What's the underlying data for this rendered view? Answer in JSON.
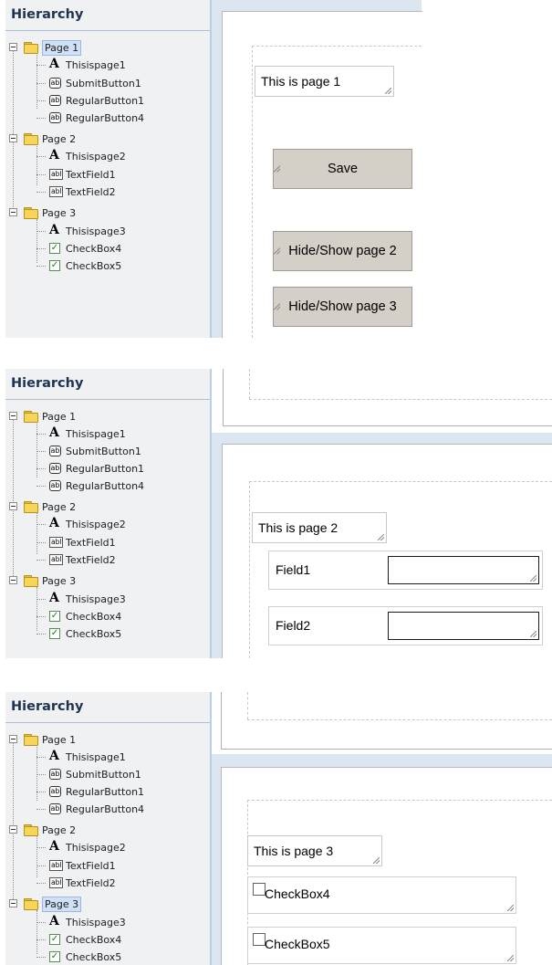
{
  "hierarchy": {
    "title": "Hierarchy",
    "pages": [
      {
        "label": "Page 1",
        "children": [
          {
            "icon": "text-A-icon",
            "label": "Thisispage1"
          },
          {
            "icon": "button-ab-icon",
            "label": "SubmitButton1"
          },
          {
            "icon": "button-ab-icon",
            "label": "RegularButton1"
          },
          {
            "icon": "button-ab-icon",
            "label": "RegularButton4"
          }
        ]
      },
      {
        "label": "Page 2",
        "children": [
          {
            "icon": "text-A-icon",
            "label": "Thisispage2"
          },
          {
            "icon": "textfield-abl-icon",
            "label": "TextField1"
          },
          {
            "icon": "textfield-abl-icon",
            "label": "TextField2"
          }
        ]
      },
      {
        "label": "Page 3",
        "children": [
          {
            "icon": "text-A-icon",
            "label": "Thisispage3"
          },
          {
            "icon": "checkbox-icon",
            "label": "CheckBox4"
          },
          {
            "icon": "checkbox-icon",
            "label": "CheckBox5"
          }
        ]
      }
    ]
  },
  "icon_glyphs": {
    "text": "A",
    "button": "ab",
    "textfield": "abl",
    "check": "✓"
  },
  "screens": [
    {
      "selected_page": "Page 1",
      "canvas": {
        "title_text": "This is page 1",
        "buttons": [
          "Save",
          "Hide/Show page 2",
          "Hide/Show page 3"
        ]
      }
    },
    {
      "selected_page": "none",
      "canvas": {
        "title_text": "This is page 2",
        "fields": [
          {
            "label": "Field1",
            "value": ""
          },
          {
            "label": "Field2",
            "value": ""
          }
        ]
      }
    },
    {
      "selected_page": "Page 3",
      "canvas": {
        "title_text": "This is page 3",
        "checkboxes": [
          {
            "label": "CheckBox4",
            "checked": false
          },
          {
            "label": "CheckBox5",
            "checked": false
          }
        ]
      }
    }
  ],
  "colors": {
    "panel_bg": "#f0f1f2",
    "title_text": "#1f3350",
    "selection_bg": "#cfe0f7",
    "button_bg": "#d4d0c8",
    "folder_yellow": "#f5d55a"
  }
}
